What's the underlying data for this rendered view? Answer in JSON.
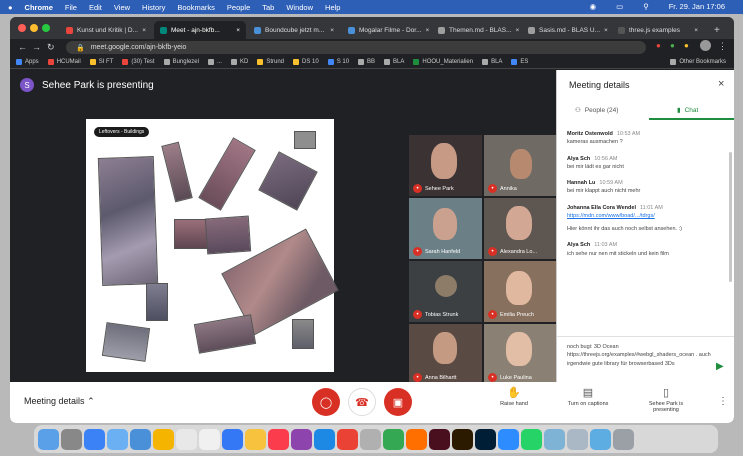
{
  "menubar": {
    "items": [
      "Chrome",
      "File",
      "Edit",
      "View",
      "History",
      "Bookmarks",
      "People",
      "Tab",
      "Window",
      "Help"
    ],
    "clock": "Fr. 29. Jan 17:06"
  },
  "browser": {
    "tabs": [
      {
        "label": "Kunst und Kritik | D...",
        "color": "#e8453c"
      },
      {
        "label": "Meet - ajn-bkfb...",
        "color": "#00897b"
      },
      {
        "label": "Boundcube jetzt m...",
        "color": "#4a90d9"
      },
      {
        "label": "Mogalar Filme - Dor...",
        "color": "#4a90d9"
      },
      {
        "label": "Themen.md - BLAS...",
        "color": "#9e9e9e"
      },
      {
        "label": "Sasis.md - BLAS U...",
        "color": "#9e9e9e"
      },
      {
        "label": "three.js examples",
        "color": "#555555"
      }
    ],
    "url": "meet.google.com/ajn-bkfb-yeio",
    "bookmarks": [
      "Apps",
      "HCUMail",
      "SI FT",
      "(30) Test",
      "Bunglezel",
      "...",
      "KD",
      "Strund",
      "DS 10",
      "S 10",
      "BB",
      "BLA",
      "HOOU_Materialien",
      "BLA",
      "ES"
    ],
    "other_bookmarks": "Other Bookmarks"
  },
  "meeting": {
    "presenter_initial": "S",
    "presenter_banner": "Sehee Park is presenting",
    "slide_label": "Leftovers - Buildings",
    "participants": [
      {
        "name": "Sehee Park"
      },
      {
        "name": "Annika"
      },
      {
        "name": "Sarah Hanfeld"
      },
      {
        "name": "Alexandra Lo..."
      },
      {
        "name": "Tobias Strunk"
      },
      {
        "name": "Emilia Preuch"
      },
      {
        "name": "Anna Bilhartt"
      },
      {
        "name": "Luke Paulina"
      }
    ]
  },
  "panel": {
    "title": "Meeting details",
    "people_tab": "People (24)",
    "chat_tab": "Chat",
    "messages": [
      {
        "who": "Moritz Ostenwold",
        "time": "10:53 AM",
        "lines": [
          "kameras ausmachen ?"
        ]
      },
      {
        "who": "Alya Sch",
        "time": "10:56 AM",
        "lines": [
          "bei mir lädt es gar nicht"
        ]
      },
      {
        "who": "Hannah Lu",
        "time": "10:59 AM",
        "lines": [
          "bei mir klappt auch nicht mehr"
        ]
      },
      {
        "who": "Johanna Ella Cora Wendel",
        "time": "11:01 AM",
        "lines": [
          "https://mdn.com/www/boad/.../tdrgs/"
        ],
        "link": true,
        "extra": "Hier könnt ihr das auch noch selbst ansehen. :)"
      },
      {
        "who": "Alya Sch",
        "time": "11:03 AM",
        "lines": [
          "ich sehe nur nen mit stickeln und kein film"
        ]
      }
    ],
    "compose": "noch bugi: 3D Ocean https://threejs.org/examples/#webgl_shaders_ocean . auch irgendwie gute library für browserbased 3Ds"
  },
  "bottom": {
    "meeting_details": "Meeting details",
    "raise_hand": "Raise hand",
    "captions": "Turn on captions",
    "presenting": "Sehee Park is presenting"
  },
  "colors": {
    "accent_green": "#1e8e3e",
    "alert_red": "#d93025",
    "menubar_blue": "#2e5fb6"
  }
}
